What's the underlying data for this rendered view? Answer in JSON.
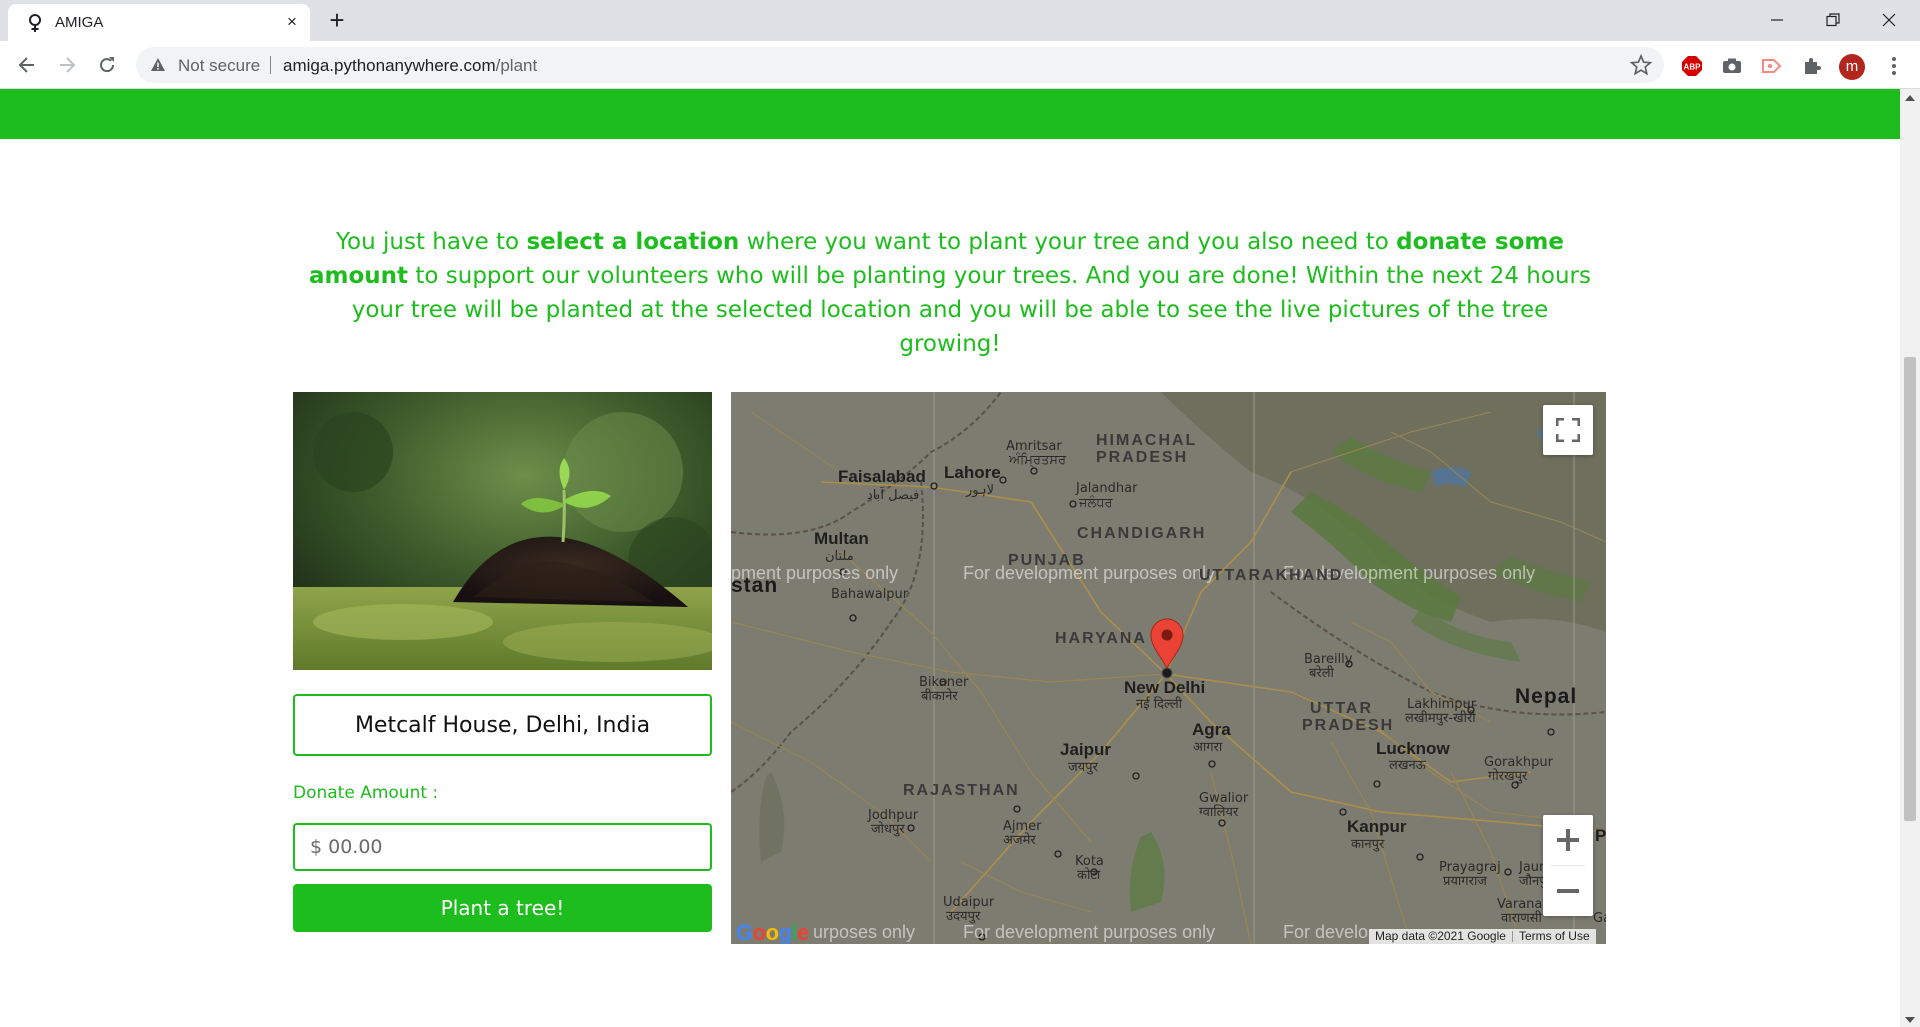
{
  "browser": {
    "tab_title": "AMIGA",
    "new_tab": "+",
    "close_tab": "×",
    "security_label": "Not secure",
    "url_host": "amiga.pythonanywhere.com",
    "url_path": "/plant",
    "profile_initial": "m",
    "extensions": [
      "adblock-plus-icon",
      "camera-icon",
      "screencast-icon",
      "puzzle-extensions-icon"
    ]
  },
  "page": {
    "intro": {
      "t1": "You just have to ",
      "b1": "select a location",
      "t2": " where you want to plant your tree and you also need to ",
      "b2": "donate some amount",
      "t3": " to support our volunteers who will be planting your trees. And you are done! Within the next 24 hours your tree will be planted at the selected location and you will be able to see the live pictures of the tree growing!"
    },
    "location_value": "Metcalf House, Delhi, India",
    "donate_label": "Donate Amount :",
    "amount_placeholder": "$ 00.00",
    "submit_label": "Plant a tree!",
    "accent_color": "#1dbd1d"
  },
  "map": {
    "dev_watermark": "For development purposes only",
    "dev_watermark_partial_left": "pment purposes only",
    "dev_watermark_partial_bottom_left": "urposes only",
    "dev_watermark_partial_right": "For develo",
    "attribution": "Map data ©2021 Google",
    "terms": "Terms of Use",
    "google_logo": "Google",
    "fullscreen_icon": "fullscreen-icon",
    "zoom_in": "+",
    "zoom_out": "−",
    "marker": "New Delhi",
    "labels": {
      "stan": "stan",
      "himachal1": "HIMACHAL",
      "himachal2": "PRADESH",
      "faisalabad": "Faisalabad",
      "faisalabad_ur": "فیصل آباد",
      "lahore": "Lahore",
      "lahore_ur": "لاہور",
      "amritsar": "Amritsar",
      "amritsar_pa": "ਅੰਮ੍ਰਿਤਸਰ",
      "jalandhar": "Jalandhar",
      "jalandhar_pa": "ਜਲੰਧਰ",
      "multan": "Multan",
      "multan_ur": "ملتان",
      "chandigarh": "CHANDIGARH",
      "punjab": "PUNJAB",
      "uttarakhand": "UTTARAKHAND",
      "bahawalpur": "Bahawalpur",
      "haryana": "HARYANA",
      "bareilly": "Bareilly",
      "bareilly_hi": "बरेली",
      "bikaner": "Bikaner",
      "bikaner_hi": "बीकानेर",
      "new_delhi": "New Delhi",
      "new_delhi_hi": "नई दिल्ली",
      "nepal": "Nepal",
      "uttar": "UTTAR",
      "pradesh": "PRADESH",
      "lakhimpur": "Lakhimpur",
      "lakhimpur_hi": "लखीमपुर-खीरी",
      "jaipur": "Jaipur",
      "jaipur_hi": "जयपुर",
      "agra": "Agra",
      "agra_hi": "आगरा",
      "lucknow": "Lucknow",
      "lucknow_hi": "लखनऊ",
      "gorakhpur": "Gorakhpur",
      "gorakhpur_hi": "गोरखपुर",
      "rajasthan": "RAJASTHAN",
      "gwalior": "Gwalior",
      "gwalior_hi": "ग्वालियर",
      "jodhpur": "Jodhpur",
      "jodhpur_hi": "जोधपुर",
      "ajmer": "Ajmer",
      "ajmer_hi": "अजमेर",
      "kanpur": "Kanpur",
      "kanpur_hi": "कानपुर",
      "prayagraj": "Prayagraj",
      "prayagraj_hi": "प्रयागराज",
      "jaunpur": "Jaunpur",
      "jaunpur_hi": "जौनपुर",
      "kota": "Kota",
      "kota_hi": "कोटा",
      "varanasi": "Varanasi",
      "varanasi_hi": "वाराणसी",
      "udaipur": "Udaipur",
      "udaipur_hi": "उदयपुर",
      "edge_p": "P",
      "edge_ga": "Ga"
    }
  }
}
